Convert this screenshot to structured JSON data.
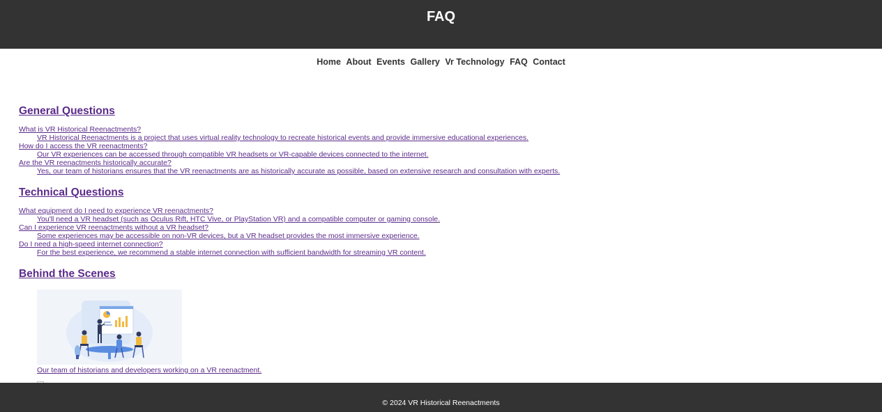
{
  "header": {
    "title": "FAQ"
  },
  "nav": {
    "items": [
      {
        "label": "Home"
      },
      {
        "label": "About"
      },
      {
        "label": "Events"
      },
      {
        "label": "Gallery"
      },
      {
        "label": "Vr Technology"
      },
      {
        "label": "FAQ"
      },
      {
        "label": "Contact"
      }
    ]
  },
  "sections": [
    {
      "title": "General Questions",
      "faqs": [
        {
          "question": "What is VR Historical Reenactments?",
          "answer": "VR Historical Reenactments is a project that uses virtual reality technology to recreate historical events and provide immersive educational experiences."
        },
        {
          "question": "How do I access the VR reenactments?",
          "answer": "Our VR experiences can be accessed through compatible VR headsets or VR-capable devices connected to the internet."
        },
        {
          "question": "Are the VR reenactments historically accurate?",
          "answer": "Yes, our team of historians ensures that the VR reenactments are as historically accurate as possible, based on extensive research and consultation with experts."
        }
      ]
    },
    {
      "title": "Technical Questions",
      "faqs": [
        {
          "question": "What equipment do I need to experience VR reenactments?",
          "answer": "You'll need a VR headset (such as Oculus Rift, HTC Vive, or PlayStation VR) and a compatible computer or gaming console."
        },
        {
          "question": "Can I experience VR reenactments without a VR headset?",
          "answer": "Some experiences may be accessible on non-VR devices, but a VR headset provides the most immersive experience."
        },
        {
          "question": "Do I need a high-speed internet connection?",
          "answer": "For the best experience, we recommend a stable internet connection with sufficient bandwidth for streaming VR content."
        }
      ]
    },
    {
      "title": "Behind the Scenes",
      "figure": {
        "image": "team-meeting-illustration",
        "caption": "Our team of historians and developers working on a VR reenactment."
      }
    }
  ],
  "footer": {
    "text": "© 2024 VR Historical Reenactments"
  },
  "colors": {
    "header_bg": "#333333",
    "link": "#5b2b8a",
    "nav_text": "#333333",
    "illustration_bg": "#f1f4f9"
  }
}
